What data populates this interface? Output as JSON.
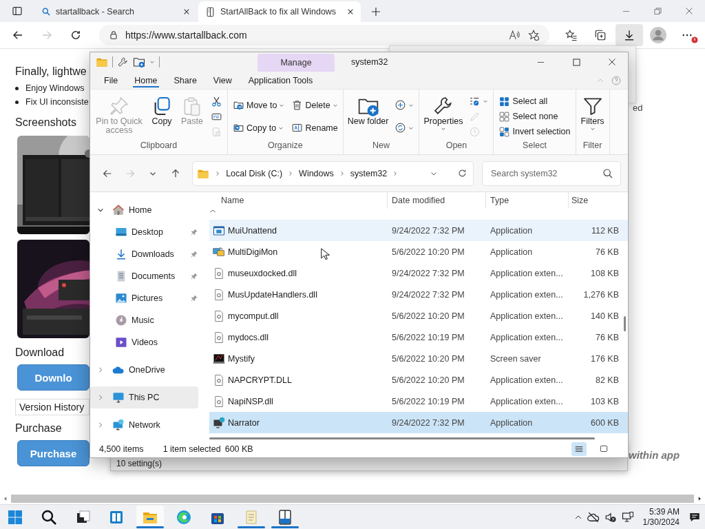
{
  "browser": {
    "tabs": [
      {
        "title": "startallback - Search",
        "kind": "search",
        "selected": false
      },
      {
        "title": "StartAllBack to fix all Windows",
        "kind": "page",
        "selected": true
      }
    ],
    "forward_button": {
      "disabled": true
    },
    "url": "https://www.startallback.com",
    "downloads_active": true,
    "more_badge": true
  },
  "page": {
    "heading": "Finally, lightwe",
    "bullets": [
      "Enjoy Windows",
      "Fix UI inconsiste"
    ],
    "screenshots_heading": "Screenshots",
    "screenshots": [
      {
        "kind": "picture"
      },
      {
        "kind": "picture"
      }
    ],
    "download_heading": "Download",
    "download_button": "Downlo",
    "version_history": "Version History",
    "purchase_heading": "Purchase",
    "purchase_button": "Purchase",
    "right_fragment": "ed",
    "right_note": "within app"
  },
  "settings_window": {
    "status": "10 setting(s)"
  },
  "explorer": {
    "title": "system32",
    "context_tab": "Manage",
    "ribbon_tabs": [
      {
        "label": "File",
        "selected": false
      },
      {
        "label": "Home",
        "selected": true
      },
      {
        "label": "Share",
        "selected": false
      },
      {
        "label": "View",
        "selected": false
      },
      {
        "label": "Application Tools",
        "selected": false
      }
    ],
    "ribbon_groups": [
      {
        "label": "Clipboard",
        "columns": [
          [
            {
              "kind": "pin",
              "label": "Pin to Quick access",
              "disabled": true,
              "dropdown": false
            }
          ],
          [
            {
              "kind": "copy",
              "label": "Copy",
              "disabled": false,
              "dropdown": false
            }
          ],
          [
            {
              "kind": "paste",
              "label": "Paste",
              "disabled": true,
              "dropdown": false
            }
          ],
          [
            {
              "kind": "cut",
              "disabled": false,
              "dropdown": false
            },
            {
              "kind": "copypath",
              "disabled": false,
              "dropdown": false
            },
            {
              "kind": "shortcut",
              "disabled": true,
              "dropdown": false
            }
          ]
        ]
      },
      {
        "label": "Organize",
        "columns": [
          [
            {
              "kind": "moveto",
              "label": "Move to",
              "disabled": false,
              "dropdown": true
            },
            {
              "kind": "copyto",
              "label": "Copy to",
              "disabled": false,
              "dropdown": true
            }
          ],
          [
            {
              "kind": "delete",
              "label": "Delete",
              "disabled": false,
              "dropdown": true
            },
            {
              "kind": "rename",
              "label": "Rename",
              "disabled": false,
              "dropdown": false
            }
          ]
        ]
      },
      {
        "label": "New",
        "columns": [
          [
            {
              "kind": "newfolder",
              "label": "New folder",
              "disabled": false,
              "dropdown": false
            }
          ],
          [
            {
              "kind": "newitem",
              "disabled": false,
              "dropdown": true
            },
            {
              "kind": "easyaccess",
              "disabled": false,
              "dropdown": true
            }
          ]
        ]
      },
      {
        "label": "Open",
        "columns": [
          [
            {
              "kind": "properties",
              "label": "Properties",
              "disabled": false,
              "dropdown": true
            }
          ],
          [
            {
              "kind": "open",
              "disabled": false,
              "dropdown": true
            },
            {
              "kind": "edit",
              "disabled": true,
              "dropdown": false
            },
            {
              "kind": "history",
              "disabled": true,
              "dropdown": false
            }
          ]
        ]
      },
      {
        "label": "Select",
        "columns": [
          [
            {
              "kind": "selectall",
              "label": "Select all",
              "disabled": false,
              "dropdown": false
            },
            {
              "kind": "selectnone",
              "label": "Select none",
              "disabled": false,
              "dropdown": false
            },
            {
              "kind": "invert",
              "label": "Invert selection",
              "disabled": false,
              "dropdown": false
            }
          ]
        ]
      },
      {
        "label": "Filter",
        "columns": [
          [
            {
              "kind": "filters",
              "label": "Filters",
              "disabled": false,
              "dropdown": true
            }
          ]
        ]
      }
    ],
    "forward_button": {
      "disabled": true
    },
    "breadcrumb": [
      "Local Disk (C:)",
      "Windows",
      "system32"
    ],
    "search": {
      "placeholder": "Search system32"
    },
    "nav": [
      {
        "label": "Home",
        "kind": "home",
        "expanded": true,
        "selected": false,
        "children": [
          {
            "label": "Desktop",
            "kind": "desktop",
            "pinned": true,
            "selected": false
          },
          {
            "label": "Downloads",
            "kind": "downloads",
            "pinned": true,
            "selected": false
          },
          {
            "label": "Documents",
            "kind": "documents",
            "pinned": true,
            "selected": false
          },
          {
            "label": "Pictures",
            "kind": "pictures",
            "pinned": true,
            "selected": false
          },
          {
            "label": "Music",
            "kind": "music",
            "pinned": false,
            "selected": false
          },
          {
            "label": "Videos",
            "kind": "videos",
            "pinned": false,
            "selected": false
          }
        ]
      },
      {
        "label": "OneDrive",
        "kind": "onedrive",
        "expanded": false,
        "selected": false
      },
      {
        "label": "This PC",
        "kind": "thispc",
        "expanded": false,
        "selected": true
      },
      {
        "label": "Network",
        "kind": "network",
        "expanded": false,
        "selected": false
      }
    ],
    "columns": [
      "Name",
      "Date modified",
      "Type",
      "Size"
    ],
    "files": [
      {
        "name": "MuiUnattend",
        "kind": "app",
        "date": "9/24/2022 7:32 PM",
        "type": "Application",
        "size": "112 KB",
        "selected": false,
        "hovered": true
      },
      {
        "name": "MultiDigiMon",
        "kind": "multimon",
        "date": "5/6/2022 10:20 PM",
        "type": "Application",
        "size": "76 KB",
        "selected": false,
        "hovered": false
      },
      {
        "name": "museuxdocked.dll",
        "kind": "dll",
        "date": "9/24/2022 7:32 PM",
        "type": "Application exten...",
        "size": "108 KB",
        "selected": false,
        "hovered": false
      },
      {
        "name": "MusUpdateHandlers.dll",
        "kind": "dll",
        "date": "9/24/2022 7:32 PM",
        "type": "Application exten...",
        "size": "1,276 KB",
        "selected": false,
        "hovered": false
      },
      {
        "name": "mycomput.dll",
        "kind": "dll",
        "date": "5/6/2022 10:20 PM",
        "type": "Application exten...",
        "size": "140 KB",
        "selected": false,
        "hovered": false
      },
      {
        "name": "mydocs.dll",
        "kind": "dll",
        "date": "5/6/2022 10:19 PM",
        "type": "Application exten...",
        "size": "76 KB",
        "selected": false,
        "hovered": false
      },
      {
        "name": "Mystify",
        "kind": "screensaver",
        "date": "5/6/2022 10:20 PM",
        "type": "Screen saver",
        "size": "176 KB",
        "selected": false,
        "hovered": false
      },
      {
        "name": "NAPCRYPT.DLL",
        "kind": "dll",
        "date": "5/6/2022 10:20 PM",
        "type": "Application exten...",
        "size": "82 KB",
        "selected": false,
        "hovered": false
      },
      {
        "name": "NapiNSP.dll",
        "kind": "dll",
        "date": "5/6/2022 10:19 PM",
        "type": "Application exten...",
        "size": "103 KB",
        "selected": false,
        "hovered": false
      },
      {
        "name": "Narrator",
        "kind": "narrator",
        "date": "9/24/2022 7:32 PM",
        "type": "Application",
        "size": "600 KB",
        "selected": true,
        "hovered": false
      }
    ],
    "status": {
      "count": "4,500 items",
      "selection": "1 item selected",
      "size": "600 KB"
    },
    "views": [
      {
        "kind": "details",
        "selected": true
      },
      {
        "kind": "tiles",
        "selected": false
      }
    ]
  },
  "taskbar": {
    "apps": [
      {
        "kind": "start",
        "running": false,
        "active": false
      },
      {
        "kind": "search",
        "running": false,
        "active": false
      },
      {
        "kind": "taskview",
        "running": false,
        "active": false
      },
      {
        "kind": "widgets",
        "running": false,
        "active": false
      },
      {
        "kind": "explorer",
        "running": true,
        "active": true
      },
      {
        "kind": "edge",
        "running": false,
        "active": false
      },
      {
        "kind": "store",
        "running": false,
        "active": false
      },
      {
        "kind": "notes",
        "running": true,
        "active": false
      },
      {
        "kind": "reader",
        "running": true,
        "active": false
      }
    ],
    "time": "5:39 AM",
    "date": "1/30/2024"
  }
}
